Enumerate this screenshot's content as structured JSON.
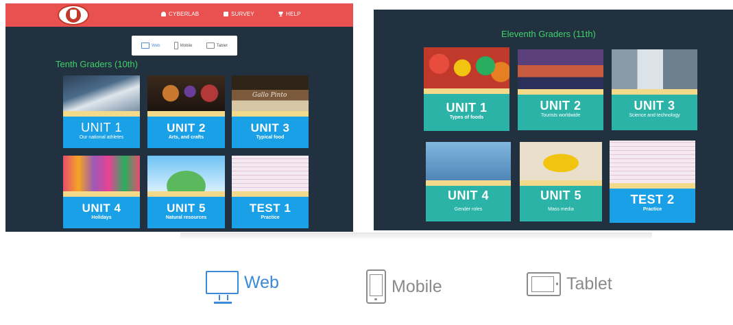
{
  "nav": {
    "items": [
      {
        "label": "CYBERLAB",
        "icon": "user-icon"
      },
      {
        "label": "SURVEY",
        "icon": "document-icon"
      },
      {
        "label": "HELP",
        "icon": "trophy-icon"
      }
    ]
  },
  "device_switch_small": {
    "web": "Web",
    "mobile": "Mobile",
    "tablet": "Tablet"
  },
  "tenth": {
    "title": "Tenth Graders (10th)",
    "cards": [
      {
        "title": "UNIT 1",
        "subtitle": "Our national athletes"
      },
      {
        "title": "UNIT 2",
        "subtitle": "Arts, and crafts"
      },
      {
        "title": "UNIT 3",
        "subtitle": "Typical food",
        "image_caption": "Gallo Pinto"
      },
      {
        "title": "UNIT 4",
        "subtitle": "Holidays"
      },
      {
        "title": "UNIT 5",
        "subtitle": "Natural resources"
      },
      {
        "title": "TEST 1",
        "subtitle": "Practice"
      }
    ]
  },
  "eleventh": {
    "title": "Eleventh Graders (11th)",
    "cards": [
      {
        "title": "UNIT 1",
        "subtitle": "Types of foods"
      },
      {
        "title": "UNIT 2",
        "subtitle": "Tourists worldwide"
      },
      {
        "title": "UNIT 3",
        "subtitle": "Science and technology"
      },
      {
        "title": "UNIT 4",
        "subtitle": "Gender roles"
      },
      {
        "title": "UNIT 5",
        "subtitle": "Mass media"
      },
      {
        "title": "TEST 2",
        "subtitle": "Practice"
      }
    ]
  },
  "device_switch_large": {
    "web": "Web",
    "mobile": "Mobile",
    "tablet": "Tablet"
  },
  "colors": {
    "nav_bg": "#e8514f",
    "panel_bg": "#22313f",
    "grade_title": "#3fd16b",
    "tenth_label": "#1aa0e6",
    "eleventh_label": "#2bb3a8",
    "active_device": "#3b8ad9"
  }
}
